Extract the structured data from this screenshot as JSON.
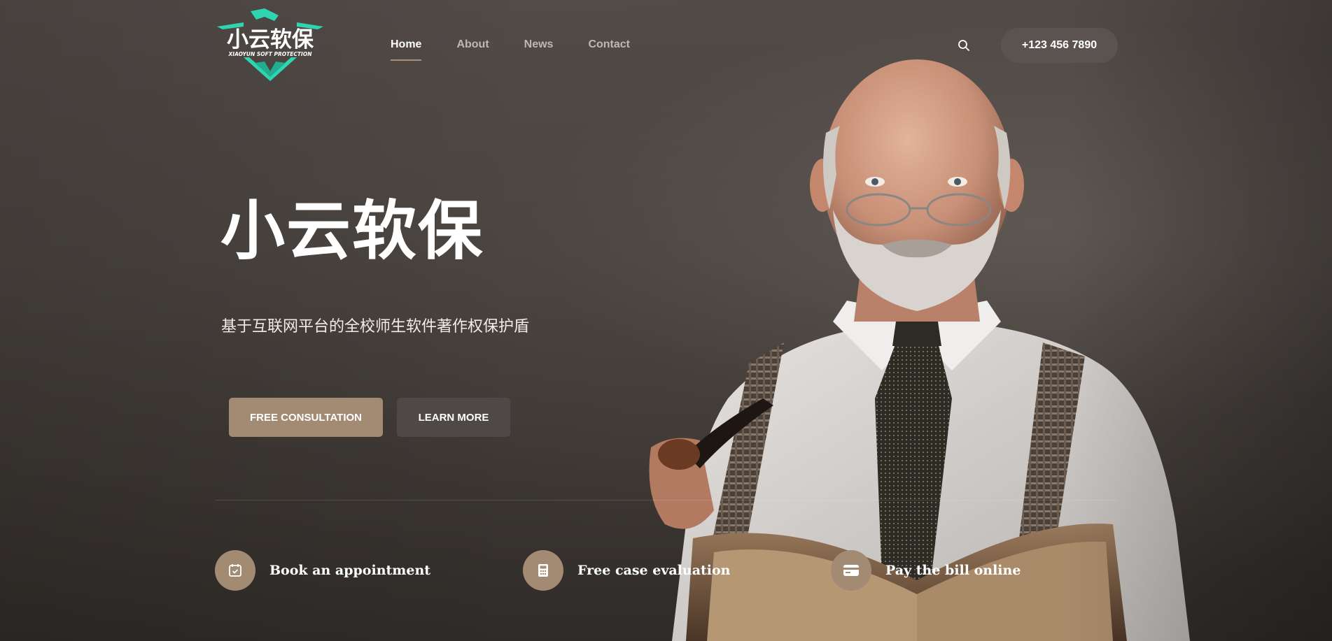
{
  "brand": {
    "logo_main": "小云软保",
    "logo_sub": "XIAOYUN SOFT PROTECTION",
    "accent": "#2fd4b0"
  },
  "nav": {
    "items": [
      {
        "label": "Home",
        "active": true
      },
      {
        "label": "About",
        "active": false
      },
      {
        "label": "News",
        "active": false
      },
      {
        "label": "Contact",
        "active": false
      }
    ]
  },
  "header": {
    "search_icon": "search-icon",
    "phone_label": "+123 456 7890"
  },
  "hero": {
    "title": "小云软保",
    "subtitle": "基于互联网平台的全校师生软件著作权保护盾",
    "primary_button": "FREE CONSULTATION",
    "secondary_button": "LEARN MORE"
  },
  "features": [
    {
      "label": "Book an appointment",
      "icon": "calendar-check-icon"
    },
    {
      "label": "Free case evaluation",
      "icon": "calculator-icon"
    },
    {
      "label": "Pay the bill online",
      "icon": "credit-card-icon"
    }
  ],
  "colors": {
    "primary_button": "#a38b73",
    "secondary_button": "#4e4846",
    "phone_button": "#5b5350"
  }
}
